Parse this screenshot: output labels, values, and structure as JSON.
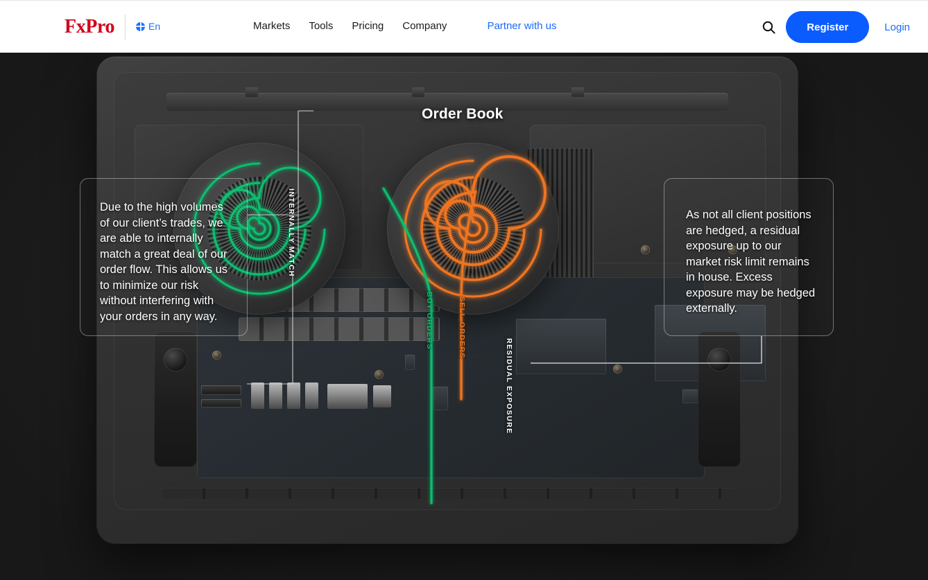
{
  "header": {
    "logo_text": "FxPro",
    "language": {
      "icon": "globe-icon",
      "label": "En"
    },
    "nav_items": [
      {
        "label": "Markets",
        "highlight": false
      },
      {
        "label": "Tools",
        "highlight": false
      },
      {
        "label": "Pricing",
        "highlight": false
      },
      {
        "label": "Company",
        "highlight": false
      },
      {
        "label": "Partner with us",
        "highlight": true
      }
    ],
    "search_icon": "search-icon",
    "register_label": "Register",
    "login_label": "Login",
    "accent_blue": "#0a5cff",
    "logo_red": "#d0021b",
    "link_blue": "#1a6aff"
  },
  "hero": {
    "title": "Order Book",
    "callout_left": "Due to the high volumes of our client’s trades, we are able to internally match a great deal of our order flow. This allows us to minimize our risk without interfering with your orders in any way.",
    "callout_right": "As not all client positions are hedged, a residual exposure up to our market risk limit remains in house. Excess exposure may be hedged externally.",
    "labels": {
      "internally_match": "INTERNALLY MATCH",
      "buy_orders": "BUY ORDERS",
      "sell_orders": "SELL ORDERS",
      "residual_exposure": "RESIDUAL\nEXPOSURE"
    },
    "colors": {
      "buy_green": "#0ebd6e",
      "sell_orange": "#ee7422",
      "stage_bg": "#242424",
      "callout_border": "rgba(255,255,255,0.38)"
    }
  }
}
